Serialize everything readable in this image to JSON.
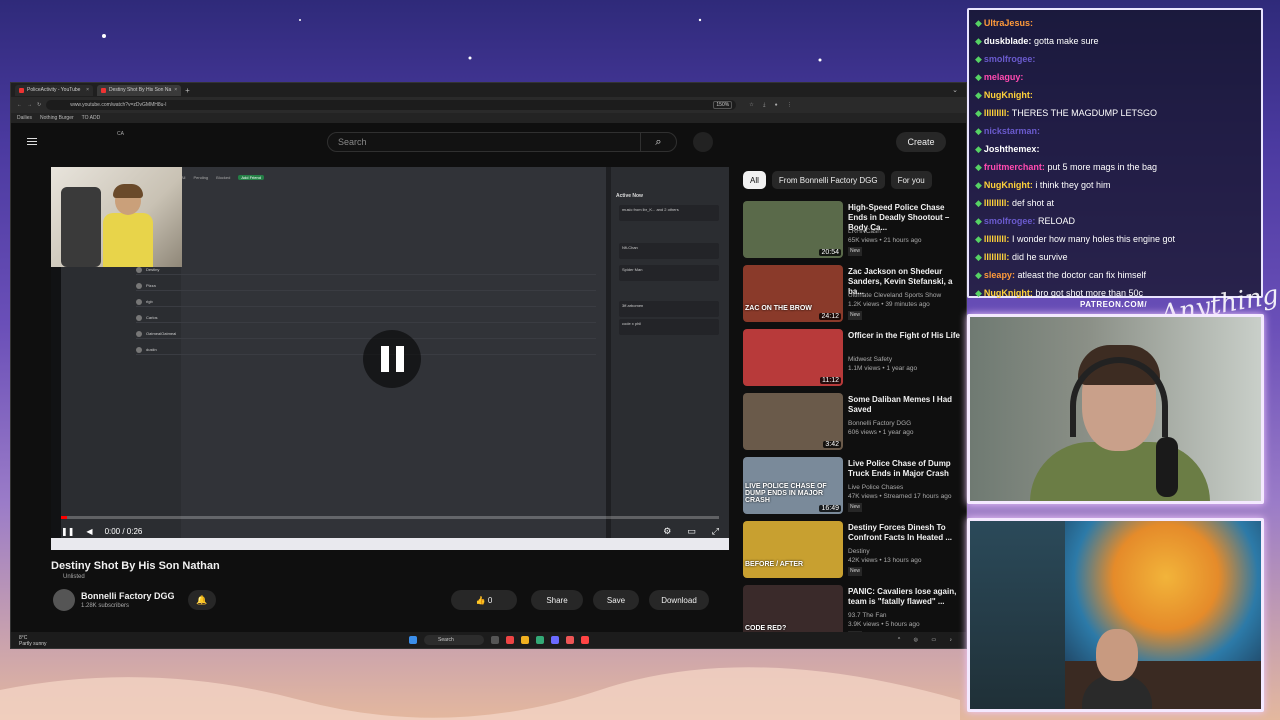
{
  "browser": {
    "tabs": [
      {
        "label": "PoliceActivity - YouTube"
      },
      {
        "label": "Destiny Shot By His Son Na"
      }
    ],
    "url": "www.youtube.com/watch?v=zDvGMMH8u-I",
    "zoom": "150%",
    "bookmarks": [
      "Dailies",
      "Nothing Burger",
      "TO ADD"
    ]
  },
  "youtube": {
    "country": "CA",
    "search_placeholder": "Search",
    "create_label": "Create",
    "player": {
      "time": "0:00 / 0:26",
      "progress": 0.0,
      "discord_tabs": [
        "All",
        "Pending",
        "Blocked",
        "Add Friend"
      ],
      "discord_rows": [
        "Destiny",
        "Pizza",
        "rlgb",
        "Carlos",
        "OatmealOatmeal",
        "dustin"
      ],
      "active_now_title": "Active Now",
      "active_rows": [
        "music from lbr_K... and 2 others",
        "Nfi-Chan",
        "Spider Man",
        "3ff.arbomen",
        "code x phil"
      ]
    },
    "video": {
      "title": "Destiny Shot By His Son Nathan",
      "visibility": "Unlisted",
      "channel": "Bonnelli Factory DGG",
      "subscribers": "1.28K subscribers",
      "likes": "0",
      "share_label": "Share",
      "save_label": "Save",
      "download_label": "Download"
    },
    "chips": [
      "All",
      "From Bonnelli Factory DGG",
      "For you"
    ],
    "recommendations": [
      {
        "title": "High-Speed Police Chase Ends in Deadly Shootout – Body Ca...",
        "channel": "LRHNCash",
        "meta": "65K views • 21 hours ago",
        "badge": "New",
        "duration": "20:54",
        "caption": "",
        "color": "#5a6a4a"
      },
      {
        "title": "Zac Jackson on Shedeur Sanders, Kevin Stefanski, a ba...",
        "channel": "Ultimate Cleveland Sports Show",
        "meta": "1.2K views • 39 minutes ago",
        "badge": "New",
        "duration": "24:12",
        "caption": "ZAC ON THE BROW",
        "color": "#8a3a2a"
      },
      {
        "title": "Officer in the Fight of His Life",
        "channel": "Midwest Safety",
        "meta": "1.1M views • 1 year ago",
        "badge": "",
        "duration": "11:12",
        "caption": "",
        "color": "#b83a3a"
      },
      {
        "title": "Some Daliban Memes I Had Saved",
        "channel": "Bonnelli Factory DGG",
        "meta": "606 views • 1 year ago",
        "badge": "",
        "duration": "3:42",
        "caption": "",
        "color": "#6a5a4a"
      },
      {
        "title": "Live Police Chase of Dump Truck Ends in Major Crash",
        "channel": "Live Police Chases",
        "meta": "47K views • Streamed 17 hours ago",
        "badge": "New",
        "duration": "16:49",
        "caption": "LIVE POLICE CHASE OF DUMP ENDS IN MAJOR CRASH",
        "color": "#7a8a9a"
      },
      {
        "title": "Destiny Forces Dinesh To Confront Facts In Heated ...",
        "channel": "Destiny",
        "meta": "42K views • 13 hours ago",
        "badge": "New",
        "duration": "",
        "caption": "BEFORE / AFTER",
        "color": "#c8a030"
      },
      {
        "title": "PANIC: Cavaliers lose again, team is \"fatally flawed\" ...",
        "channel": "93.7 The Fan",
        "meta": "3.9K views • 5 hours ago",
        "badge": "New",
        "duration": "24:27",
        "caption": "CODE RED?",
        "color": "#3a2a2a"
      }
    ]
  },
  "taskbar": {
    "weather_temp": "8°C",
    "weather_desc": "Partly sunny",
    "search_label": "Search"
  },
  "chat": {
    "messages": [
      {
        "user": "UltraJesus:",
        "text": "",
        "color": "#ff9a3a"
      },
      {
        "user": "duskblade:",
        "text": "gotta make sure",
        "color": "#ffffff"
      },
      {
        "user": "smolfrogee:",
        "text": "",
        "color": "#6a5acd"
      },
      {
        "user": "melaguy:",
        "text": "",
        "color": "#ff4ab0"
      },
      {
        "user": "NugKnight:",
        "text": "",
        "color": "#ffd23a"
      },
      {
        "user": "lllllllll:",
        "text": "THERES THE MAGDUMP LETSGO",
        "color": "#ffd23a"
      },
      {
        "user": "nickstarman:",
        "text": "",
        "color": "#6a5acd"
      },
      {
        "user": "Joshthemex:",
        "text": "",
        "color": "#ffffff"
      },
      {
        "user": "fruitmerchant:",
        "text": "put 5 more mags in the bag",
        "color": "#ff4ab0"
      },
      {
        "user": "NugKnight:",
        "text": "i think they got him",
        "color": "#ffd23a"
      },
      {
        "user": "lllllllll:",
        "text": "def shot at",
        "color": "#ffd23a"
      },
      {
        "user": "smolfrogee:",
        "text": "RELOAD",
        "color": "#6a5acd"
      },
      {
        "user": "lllllllll:",
        "text": "I wonder how many holes this engine got",
        "color": "#ffd23a"
      },
      {
        "user": "lllllllll:",
        "text": "did he survive",
        "color": "#ffd23a"
      },
      {
        "user": "sleapy:",
        "text": "atleast the doctor can fix himself",
        "color": "#ff9a3a"
      },
      {
        "user": "NugKnight:",
        "text": "bro got shot more than 50c",
        "color": "#ffd23a"
      }
    ]
  },
  "overlay": {
    "patreon": "PATREON.COM/",
    "signature": "Anything"
  }
}
